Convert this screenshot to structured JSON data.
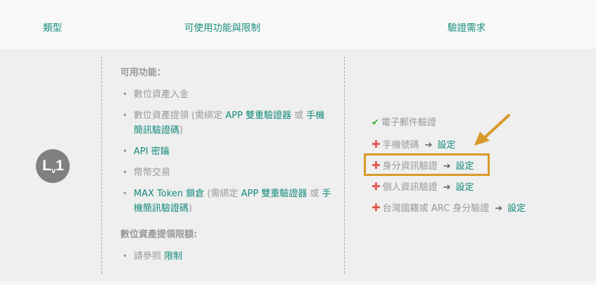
{
  "header": {
    "type": "類型",
    "functions": "可使用功能與限制",
    "verification": "驗證需求"
  },
  "level_badge": {
    "main": "L",
    "sub": "v",
    "num": "1"
  },
  "functions": {
    "title": "可用功能：",
    "items": [
      {
        "text": "數位資產入金"
      },
      {
        "a": "數位資產提領 (需綁定 ",
        "b": "APP 雙重驗證器",
        "c": " 或 ",
        "d": "手機",
        "e": "簡訊驗證碼",
        "f": ")"
      },
      {
        "text": "API 密鑰"
      },
      {
        "text": "幣幣交易"
      },
      {
        "a": "MAX Token 鎖倉",
        "b": " (需綁定 ",
        "c": "APP 雙重驗證器",
        "d": " 或 ",
        "e": "手",
        "f": "機簡訊驗證碼",
        "g": ")"
      }
    ],
    "limit_title": "數位資產提領限額:",
    "limit_items": [
      {
        "a": "請參照 ",
        "b": "限制"
      }
    ]
  },
  "verification": {
    "items": [
      {
        "label": "電子郵件驗證",
        "status": "done"
      },
      {
        "label": "手機號碼",
        "action": "設定"
      },
      {
        "label": "身分資訊驗證",
        "action": "設定"
      },
      {
        "label": "個人資訊驗證",
        "action": "設定"
      },
      {
        "label": "台灣國籍或 ARC 身分驗證",
        "action": "設定"
      }
    ]
  },
  "colors": {
    "accent": "#138a7b",
    "check": "#3fa83a",
    "required": "#e05a4e",
    "highlight": "#d99a2b",
    "badge": "#808080"
  },
  "icons": [
    "check-icon",
    "plus-icon",
    "arrow-right-icon",
    "annotation-arrow-icon"
  ]
}
